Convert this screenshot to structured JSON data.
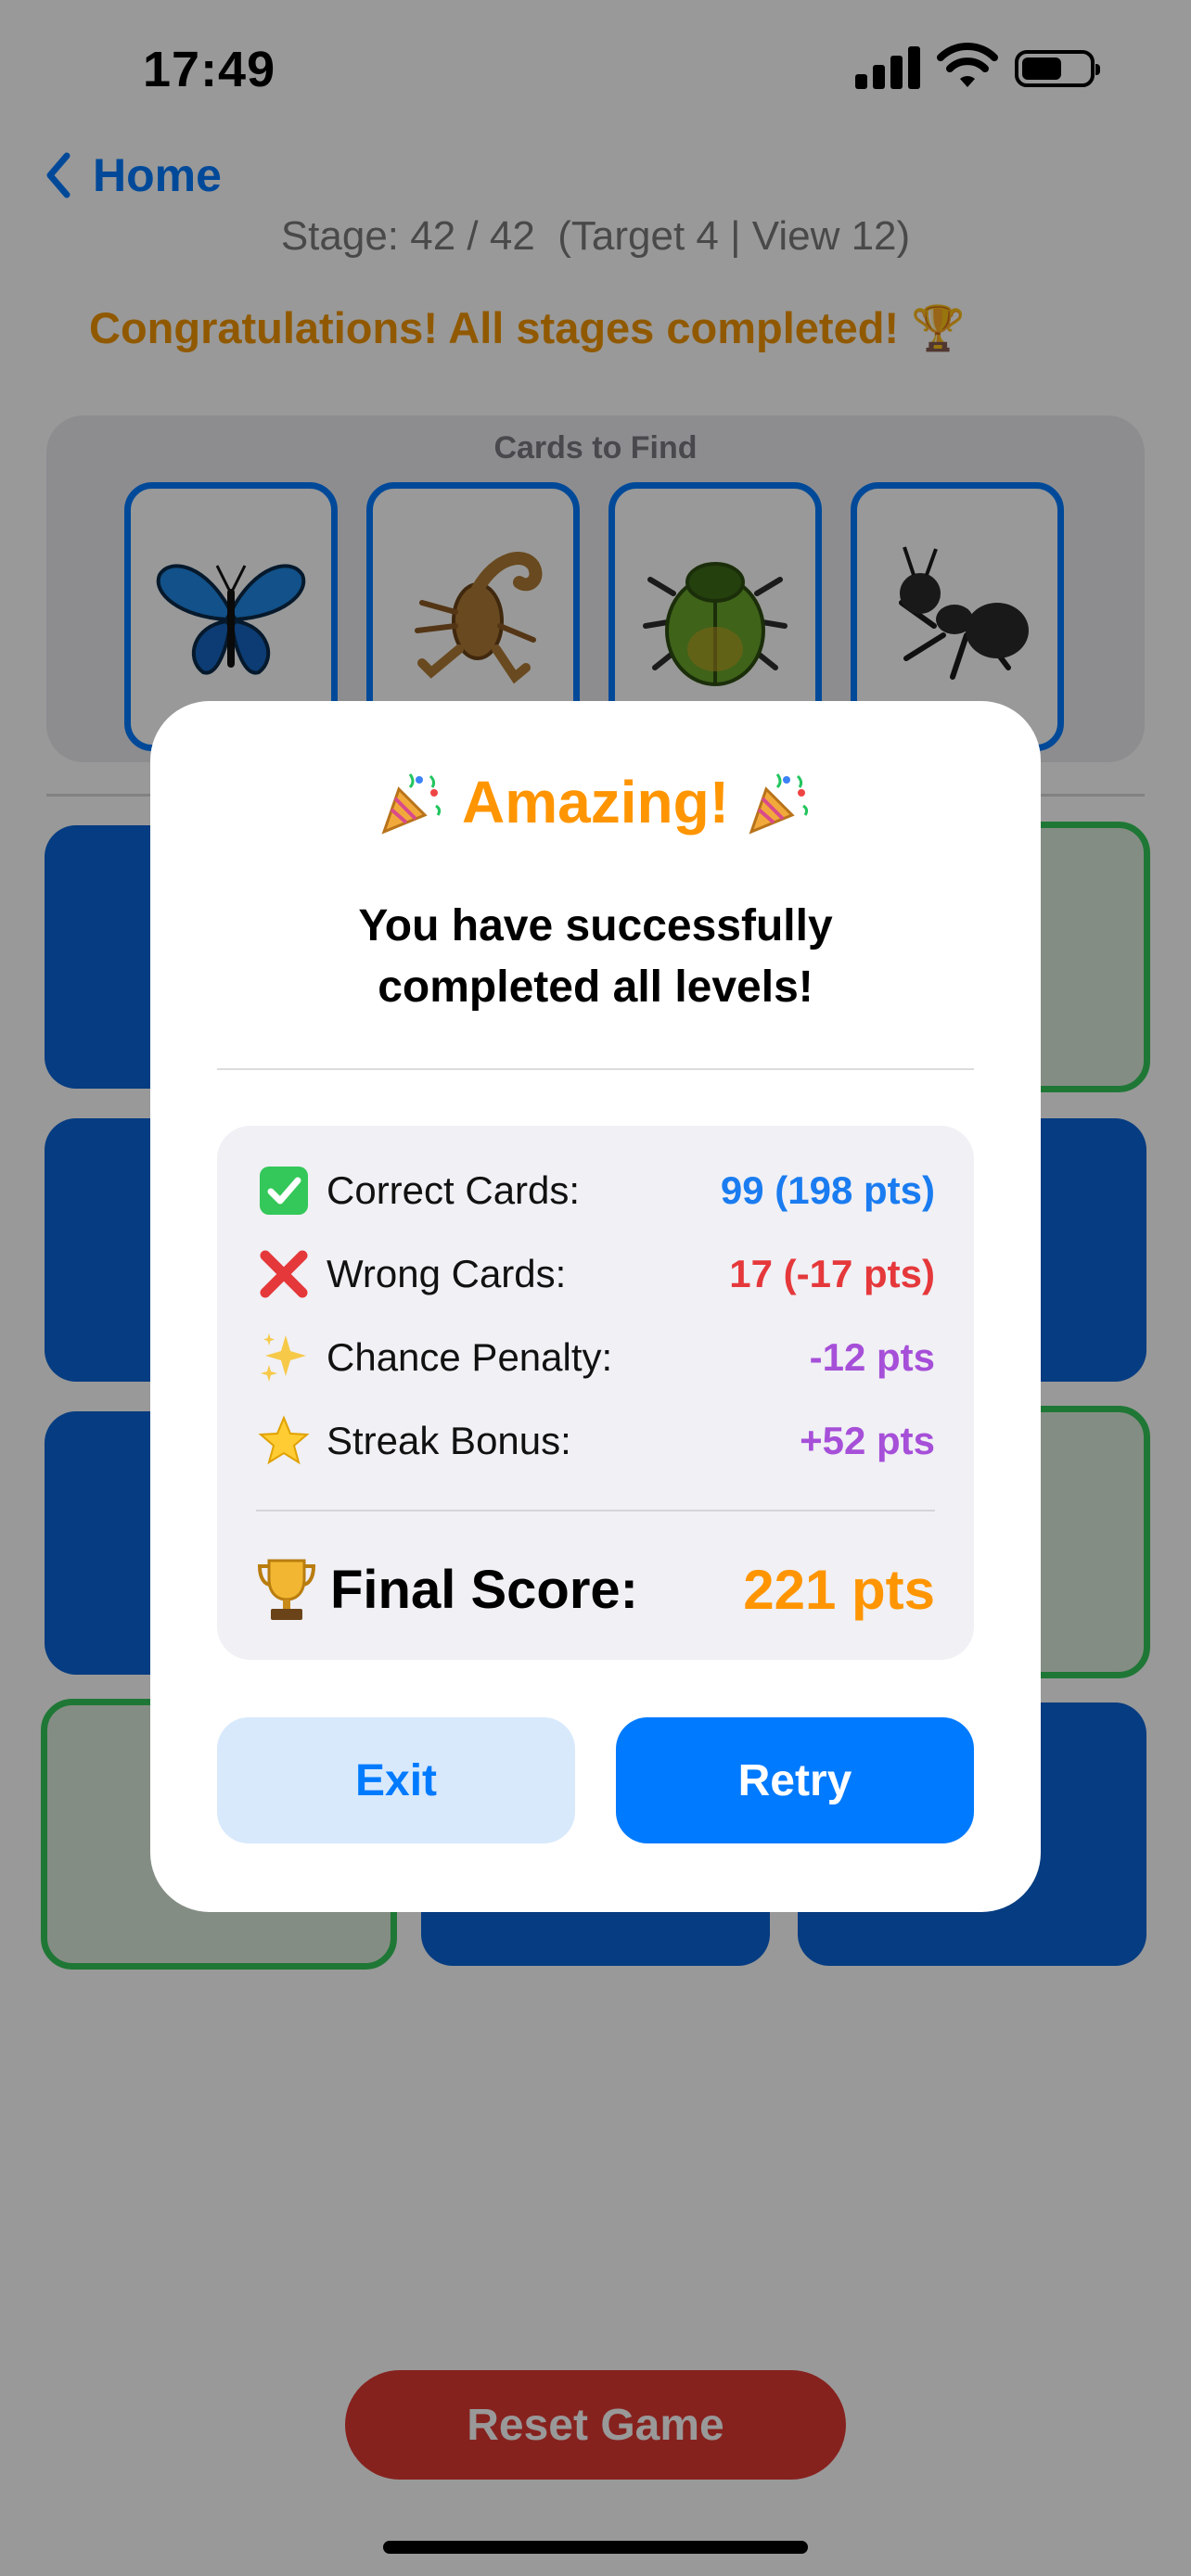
{
  "status_bar": {
    "time": "17:49"
  },
  "nav": {
    "back_label": "Home"
  },
  "game": {
    "stage_text": "Stage: 42 / 42  (Target 4 | View 12)",
    "congrats_text": "Congratulations! All stages completed! 🏆",
    "cards_title": "Cards to Find",
    "cards_to_find": [
      "butterfly-icon",
      "scorpion-icon",
      "beetle-icon",
      "ant-icon"
    ],
    "reset_label": "Reset Game"
  },
  "modal": {
    "title": "Amazing!",
    "subtitle_line1": "You have successfully",
    "subtitle_line2": "completed all levels!",
    "stats": [
      {
        "icon": "check-mark-icon",
        "label": "Correct Cards:",
        "value": "99 (198 pts)",
        "color": "#1a7cf0"
      },
      {
        "icon": "cross-mark-icon",
        "label": "Wrong Cards:",
        "value": "17 (-17 pts)",
        "color": "#e5383b"
      },
      {
        "icon": "sparkles-icon",
        "label": "Chance Penalty:",
        "value": "-12 pts",
        "color": "#a64fd8"
      },
      {
        "icon": "star-icon",
        "label": "Streak Bonus:",
        "value": "+52 pts",
        "color": "#a64fd8"
      }
    ],
    "final_label": "Final Score:",
    "final_value": "221 pts",
    "exit_label": "Exit",
    "retry_label": "Retry"
  },
  "colors": {
    "accent": "#007aff",
    "orange": "#ff9500",
    "reset": "#e03a33",
    "success": "#34c759"
  }
}
